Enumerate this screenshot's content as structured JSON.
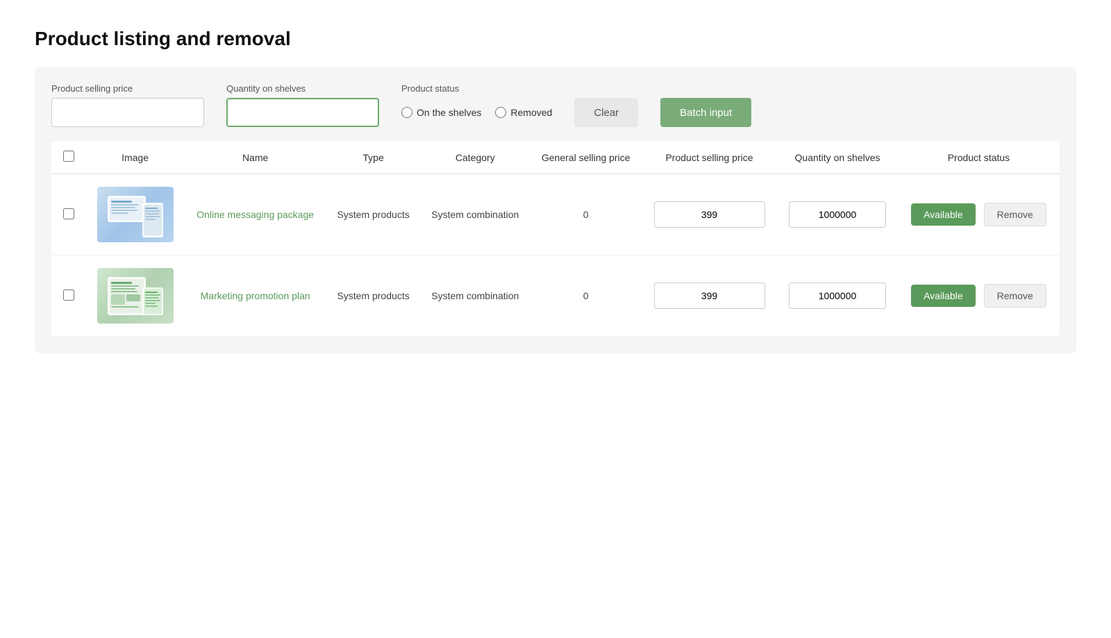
{
  "page": {
    "title": "Product listing and removal"
  },
  "filters": {
    "product_selling_price_label": "Product selling price",
    "product_selling_price_placeholder": "",
    "quantity_on_shelves_label": "Quantity on shelves",
    "quantity_on_shelves_placeholder": "",
    "product_status_label": "Product status",
    "radio_on_shelves_label": "On the shelves",
    "radio_removed_label": "Removed",
    "clear_button_label": "Clear",
    "batch_input_button_label": "Batch input"
  },
  "table": {
    "headers": {
      "checkbox": "",
      "image": "Image",
      "name": "Name",
      "type": "Type",
      "category": "Category",
      "general_selling_price": "General selling price",
      "product_selling_price": "Product selling price",
      "quantity_on_shelves": "Quantity on shelves",
      "product_status": "Product status"
    },
    "rows": [
      {
        "id": 1,
        "image_label": "online-messaging-system-image",
        "name": "Online messaging package",
        "type": "System products",
        "category": "System combination",
        "general_selling_price": "0",
        "product_selling_price": "399",
        "quantity_on_shelves": "1000000",
        "status_available_label": "Available",
        "status_remove_label": "Remove"
      },
      {
        "id": 2,
        "image_label": "marketing-promotion-image",
        "name": "Marketing promotion plan",
        "type": "System products",
        "category": "System combination",
        "general_selling_price": "0",
        "product_selling_price": "399",
        "quantity_on_shelves": "1000000",
        "status_available_label": "Available",
        "status_remove_label": "Remove"
      }
    ]
  },
  "colors": {
    "accent_green": "#5a9a5a",
    "light_green_btn": "#7aac7a",
    "clear_btn_bg": "#e8e8e8"
  }
}
